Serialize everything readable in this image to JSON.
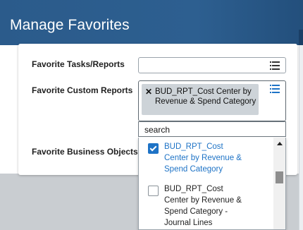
{
  "header": {
    "title": "Manage Favorites"
  },
  "fields": {
    "tasks_reports_label": "Favorite Tasks/Reports",
    "custom_reports_label": "Favorite Custom Reports",
    "business_objects_label": "Favorite Business Objects"
  },
  "custom_reports": {
    "selected_chip": "BUD_RPT_Cost Center by Revenue & Spend Category",
    "remove_glyph": "✕"
  },
  "search": {
    "value": "search"
  },
  "options": [
    {
      "label": "BUD_RPT_Cost Center by Revenue & Spend Category",
      "checked": true
    },
    {
      "label": "BUD_RPT_Cost Center by Revenue & Spend Category - Journal Lines",
      "checked": false
    }
  ],
  "colors": {
    "header": "#2d5d8c",
    "selected_text": "#1e73c6",
    "chip": "#cdd3d8"
  }
}
